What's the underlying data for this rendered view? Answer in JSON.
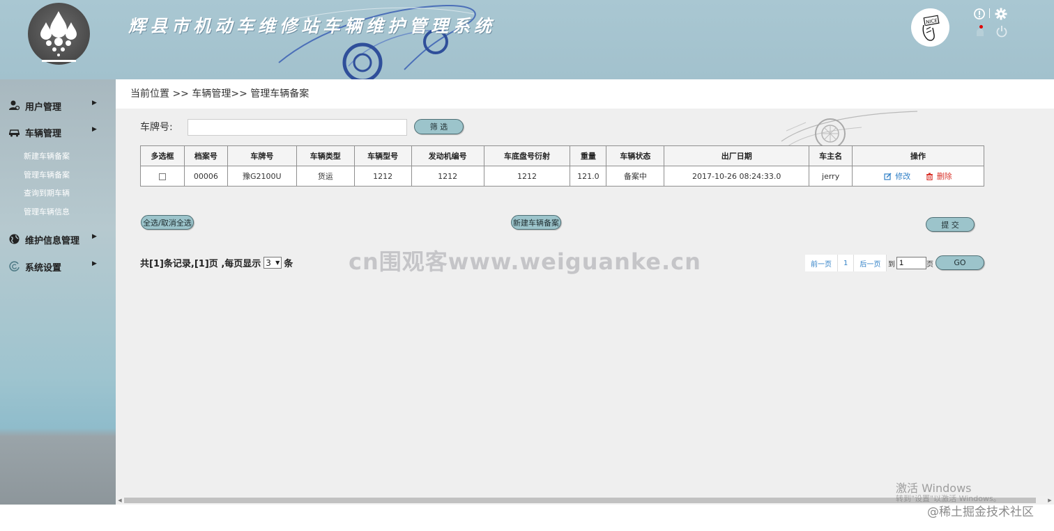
{
  "header": {
    "title": "辉县市机动车维修站车辆维护管理系统",
    "avatar_text": "NICE",
    "icons": [
      "alert-icon",
      "gear-icon",
      "notification-icon",
      "power-icon"
    ]
  },
  "sidebar": {
    "menus": [
      {
        "label": "用户管理",
        "icon": "user-icon"
      },
      {
        "label": "车辆管理",
        "icon": "car-icon"
      },
      {
        "label": "维护信息管理",
        "icon": "globe-icon"
      },
      {
        "label": "系统设置",
        "icon": "settings-swirl-icon"
      }
    ],
    "vehicle_submenu": [
      "新建车辆备案",
      "管理车辆备案",
      "查询到期车辆",
      "管理车辆信息"
    ]
  },
  "breadcrumb": "当前位置 >> 车辆管理>> 管理车辆备案",
  "filter": {
    "label": "车牌号:",
    "value": "",
    "placeholder": "",
    "button": "筛 选"
  },
  "table": {
    "columns": [
      "多选框",
      "档案号",
      "车牌号",
      "车辆类型",
      "车辆型号",
      "发动机编号",
      "车底盘号衍射",
      "重量",
      "车辆状态",
      "出厂日期",
      "车主名",
      "操作"
    ],
    "rows": [
      {
        "archive_no": "00006",
        "plate": "豫G2100U",
        "type": "货运",
        "model": "1212",
        "engine": "1212",
        "chassis": "1212",
        "weight": "121.0",
        "status": "备案中",
        "date": "2017-10-26 08:24:33.0",
        "owner": "jerry",
        "edit": "修改",
        "delete": "删除"
      }
    ]
  },
  "actions": {
    "select_all": "全选/取消全选",
    "new_record": "新建车辆备案",
    "submit": "提 交"
  },
  "pagination": {
    "summary_prefix": "共[1]条记录,[1]页 ,每页显示",
    "per_page": "3",
    "summary_suffix": "条",
    "prev": "前一页",
    "page": "1",
    "next": "后一页",
    "goto_label": "到",
    "goto_value": "1",
    "page_label": "页",
    "go": "GO"
  },
  "overlays": {
    "watermark": "cn围观客www.weiguanke.cn",
    "windows_activate": "激活 Windows",
    "windows_activate_sub": "转到\"设置\"以激活 Windows。",
    "community": "@稀土掘金技术社区"
  }
}
